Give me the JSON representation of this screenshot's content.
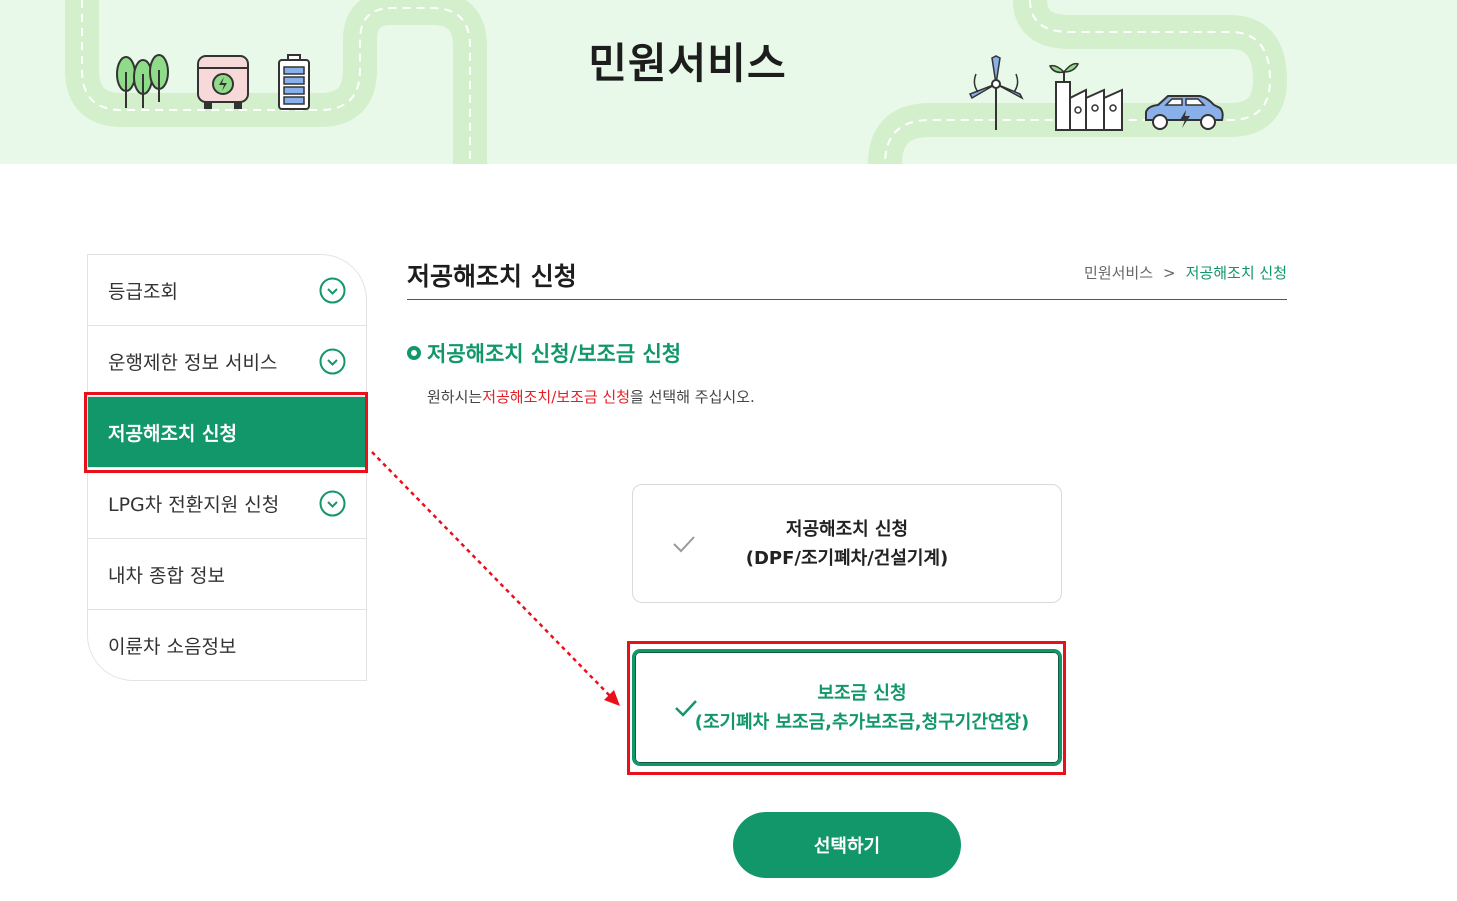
{
  "header": {
    "title": "민원서비스"
  },
  "sidebar": {
    "items": [
      {
        "label": "등급조회",
        "expandable": true
      },
      {
        "label": "운행제한 정보 서비스",
        "expandable": true
      },
      {
        "label": "저공해조치 신청",
        "active": true
      },
      {
        "label": "LPG차 전환지원 신청",
        "expandable": true
      },
      {
        "label": "내차 종합 정보"
      },
      {
        "label": "이륜차 소음정보"
      }
    ]
  },
  "main": {
    "page_title": "저공해조치 신청",
    "breadcrumb": {
      "parent": "민원서비스",
      "separator": ">",
      "current": "저공해조치 신청"
    },
    "section_title": "저공해조치 신청/보조금 신청",
    "description": {
      "prefix": "원하시는",
      "highlight": "저공해조치/보조금 신청",
      "suffix": "을 선택해 주십시오."
    },
    "options": [
      {
        "line1": "저공해조치 신청",
        "line2": "(DPF/조기폐차/건설기계)",
        "selected": false
      },
      {
        "line1": "보조금 신청",
        "line2": "(조기폐차 보조금,추가보조금,청구기간연장)",
        "selected": true
      }
    ],
    "select_button": "선택하기"
  },
  "colors": {
    "accent": "#12976a",
    "highlight_red": "#e41f26",
    "annotation_red": "#e8101a",
    "banner_bg": "#e9f9e9"
  },
  "icons": [
    "trees-icon",
    "electric-bus-icon",
    "battery-icon",
    "wind-turbine-icon",
    "factory-icon",
    "electric-car-icon",
    "chevron-down-circle-icon",
    "check-icon",
    "ring-bullet-icon"
  ]
}
